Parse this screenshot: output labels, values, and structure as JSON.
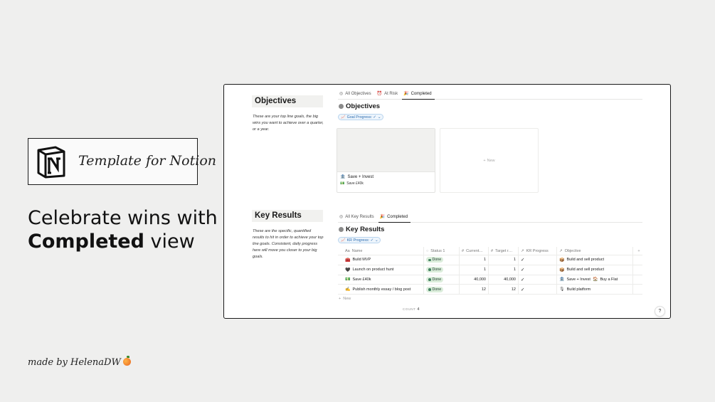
{
  "left_panel": {
    "logo_text": "Template for Notion",
    "headline_line1": "Celebrate wins with",
    "headline_bold": "Completed",
    "headline_rest": " view",
    "made_by": "made by HelenaDW"
  },
  "objectives": {
    "side_title": "Objectives",
    "side_desc": "These are your top line goals, the big wins you want to achieve over a quarter, or a year.",
    "tabs": [
      {
        "icon": "target-icon",
        "label": "All Objectives",
        "active": false
      },
      {
        "icon": "alarm-icon",
        "label": "At Risk",
        "active": false
      },
      {
        "icon": "party-popper-icon",
        "label": "Completed",
        "active": true
      }
    ],
    "db_title": "Objectives",
    "filter_label": "Goal Progress: ✓",
    "card": {
      "name": "Save + Invest",
      "sub": "Save £40k"
    },
    "new_label": "New"
  },
  "key_results": {
    "side_title": "Key Results",
    "side_desc": "These are the specific, quantified results to hit in order to achieve your top line goals. Consistent, daily progress here will move you closer to your big goals.",
    "tabs": [
      {
        "icon": "target-icon",
        "label": "All Key Results",
        "active": false
      },
      {
        "icon": "party-popper-icon",
        "label": "Completed",
        "active": true
      }
    ],
    "db_title": "Key Results",
    "filter_label": "KR Progress: ✓",
    "columns": {
      "name": "Name",
      "status": "Status 1",
      "current": "Current…",
      "target": "Target r…",
      "kr": "KR Progress",
      "objective": "Objective",
      "add": "+"
    },
    "rows": [
      {
        "icon": "toolbox-icon",
        "name": "Build MVP",
        "status": "Done",
        "current": "1",
        "target": "1",
        "kr": "✓",
        "objectives": [
          "Build and sell product"
        ]
      },
      {
        "icon": "heart-icon",
        "name": "Launch on product hunt",
        "status": "Done",
        "current": "1",
        "target": "1",
        "kr": "✓",
        "objectives": [
          "Build and sell product"
        ]
      },
      {
        "icon": "money-icon",
        "name": "Save £40k",
        "status": "Done",
        "current": "40,000",
        "target": "40,000",
        "kr": "✓",
        "objectives": [
          "Save + Invest",
          "Buy a Flat"
        ]
      },
      {
        "icon": "pen-icon",
        "name": "Publish monthly essay / blog post",
        "status": "Done",
        "current": "12",
        "target": "12",
        "kr": "✓",
        "objectives": [
          "Build platform"
        ]
      }
    ],
    "new_label": "New",
    "count_label": "COUNT",
    "count_value": "4"
  },
  "help_label": "?",
  "colors": {
    "background": "#efefee",
    "done_badge_bg": "#dbeddb",
    "done_dot": "#448361",
    "filter_blue": "#2b6cb0"
  }
}
